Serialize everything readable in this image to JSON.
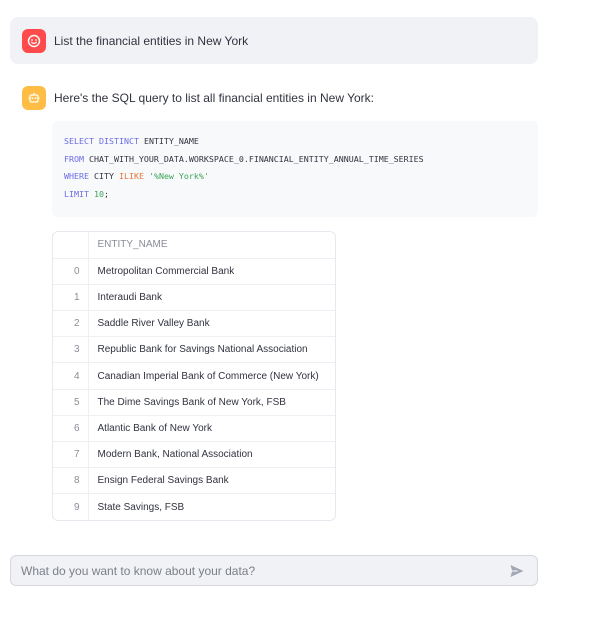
{
  "user_message": {
    "text": "List the financial entities in New York",
    "avatar_icon": "smiley-face-icon",
    "avatar_color": "#ff4b4b"
  },
  "assistant_message": {
    "text": "Here's the SQL query to list all financial entities in New York:",
    "avatar_icon": "robot-icon",
    "avatar_color": "#ffbd45",
    "sql": {
      "line1": [
        "SELECT",
        " ",
        "DISTINCT",
        " ENTITY_NAME"
      ],
      "line2": [
        "FROM",
        " CHAT_WITH_YOUR_DATA.WORKSPACE_0.FINANCIAL_ENTITY_ANNUAL_TIME_SERIES"
      ],
      "line3": [
        "WHERE",
        " CITY ",
        "ILIKE",
        " ",
        "'%New York%'"
      ],
      "line4": [
        "LIMIT",
        " ",
        "10",
        ";"
      ]
    },
    "table": {
      "column": "ENTITY_NAME",
      "rows": [
        {
          "index": "0",
          "name": "Metropolitan Commercial Bank"
        },
        {
          "index": "1",
          "name": "Interaudi Bank"
        },
        {
          "index": "2",
          "name": "Saddle River Valley Bank"
        },
        {
          "index": "3",
          "name": "Republic Bank for Savings National Association"
        },
        {
          "index": "4",
          "name": "Canadian Imperial Bank of Commerce (New York)"
        },
        {
          "index": "5",
          "name": "The Dime Savings Bank of New York, FSB"
        },
        {
          "index": "6",
          "name": "Atlantic Bank of New York"
        },
        {
          "index": "7",
          "name": "Modern Bank, National Association"
        },
        {
          "index": "8",
          "name": "Ensign Federal Savings Bank"
        },
        {
          "index": "9",
          "name": "State Savings, FSB"
        }
      ]
    }
  },
  "chat_input": {
    "placeholder": "What do you want to know about your data?",
    "value": "",
    "send_icon": "send-icon"
  }
}
